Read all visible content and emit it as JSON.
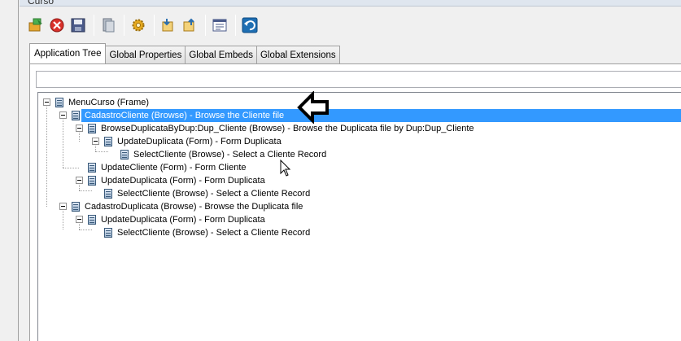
{
  "window": {
    "title": "Curso"
  },
  "toolbar": {
    "buttons": [
      {
        "name": "open-icon",
        "color": "#e8a830"
      },
      {
        "name": "cancel-icon",
        "color": "#d9312b"
      },
      {
        "name": "save-icon",
        "color": "#4a5a8a"
      },
      {
        "name": "print-icon",
        "color": "#7a8696"
      },
      {
        "name": "gear-icon",
        "color": "#e5a91f"
      },
      {
        "name": "import-icon",
        "color": "#e6a72c"
      },
      {
        "name": "export-icon",
        "color": "#e6a72c"
      },
      {
        "name": "properties-icon",
        "color": "#4a5a8a"
      },
      {
        "name": "undo-icon",
        "color": "#1f6fb3"
      }
    ]
  },
  "tabs": [
    {
      "label": "Application Tree",
      "active": true
    },
    {
      "label": "Global Properties",
      "active": false
    },
    {
      "label": "Global Embeds",
      "active": false
    },
    {
      "label": "Global Extensions",
      "active": false
    }
  ],
  "filter": {
    "value": ""
  },
  "tree": [
    {
      "level": 0,
      "expander": true,
      "label": "MenuCurso (Frame)",
      "selected": false
    },
    {
      "level": 1,
      "expander": true,
      "label": "CadastroCliente (Browse) - Browse the Cliente file",
      "selected": true
    },
    {
      "level": 2,
      "expander": true,
      "label": "BrowseDuplicataByDup:Dup_Cliente (Browse) - Browse the Duplicata file by Dup:Dup_Cliente",
      "selected": false
    },
    {
      "level": 3,
      "expander": true,
      "label": "UpdateDuplicata (Form) - Form Duplicata",
      "selected": false
    },
    {
      "level": 4,
      "expander": false,
      "label": "SelectCliente (Browse) - Select a Cliente Record",
      "selected": false
    },
    {
      "level": 2,
      "expander": false,
      "label": "UpdateCliente (Form) - Form Cliente",
      "selected": false
    },
    {
      "level": 2,
      "expander": true,
      "label": "UpdateDuplicata (Form) - Form Duplicata",
      "selected": false
    },
    {
      "level": 3,
      "expander": false,
      "label": "SelectCliente (Browse) - Select a Cliente Record",
      "selected": false
    },
    {
      "level": 1,
      "expander": true,
      "label": "CadastroDuplicata (Browse) - Browse the Duplicata file",
      "selected": false
    },
    {
      "level": 2,
      "expander": true,
      "label": "UpdateDuplicata (Form) - Form Duplicata",
      "selected": false
    },
    {
      "level": 3,
      "expander": false,
      "label": "SelectCliente (Browse) - Select a Cliente Record",
      "selected": false
    }
  ],
  "colors": {
    "selection": "#3399ff",
    "background": "#f0f0f0"
  }
}
